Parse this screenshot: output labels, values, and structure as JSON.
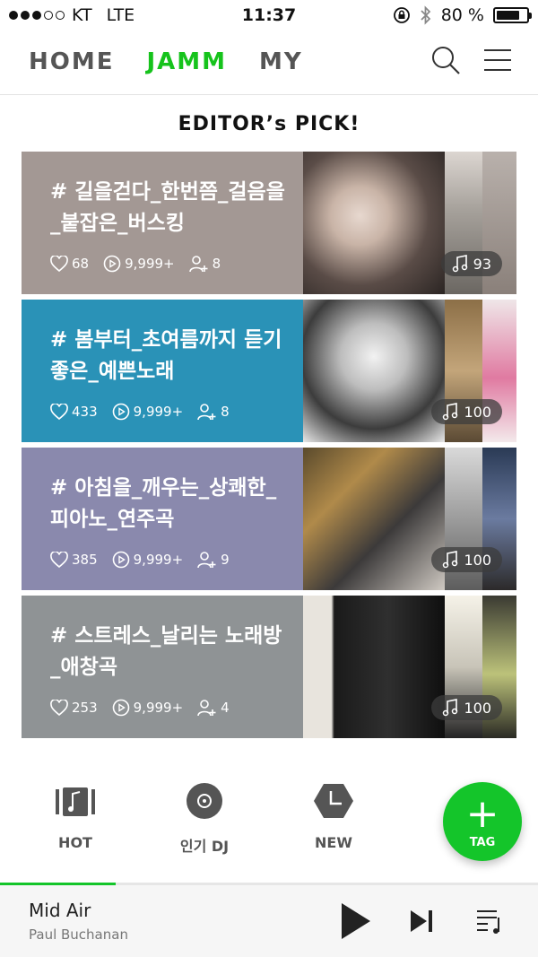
{
  "status_bar": {
    "carrier": "KT",
    "network": "LTE",
    "time": "11:37",
    "battery": "80 %",
    "battery_level": 0.8,
    "signal_bars": 3
  },
  "nav": {
    "tabs": [
      {
        "label": "HOME",
        "active": false
      },
      {
        "label": "JAMM",
        "active": true
      },
      {
        "label": "MY",
        "active": false
      }
    ],
    "accent": "#16c31c"
  },
  "section_title": "EDITOR’s  PICK!",
  "cards": [
    {
      "tag": "# 길을걷다_한번쯤_걸음을_붙잡은_버스킹",
      "likes": "68",
      "plays": "9,999+",
      "followers": "8",
      "songs": "93",
      "bg": "#a39894"
    },
    {
      "tag": "# 봄부터_초여름까지 듣기좋은_예쁜노래",
      "likes": "433",
      "plays": "9,999+",
      "followers": "8",
      "songs": "100",
      "bg": "#2a92b7"
    },
    {
      "tag": "# 아침을_깨우는_상쾌한_피아노_연주곡",
      "likes": "385",
      "plays": "9,999+",
      "followers": "9",
      "songs": "100",
      "bg": "#8a89ad"
    },
    {
      "tag": "# 스트레스_날리는 노래방_애창곡",
      "likes": "253",
      "plays": "9,999+",
      "followers": "4",
      "songs": "100",
      "bg": "#8f9395"
    }
  ],
  "categories": [
    {
      "label": "HOT",
      "icon": "hot-music-icon"
    },
    {
      "label": "인기 DJ",
      "icon": "dj-disc-icon"
    },
    {
      "label": "NEW",
      "icon": "new-clock-icon"
    }
  ],
  "fab": {
    "label": "TAG"
  },
  "player": {
    "title": "Mid Air",
    "artist": "Paul Buchanan",
    "progress": 0.215
  }
}
